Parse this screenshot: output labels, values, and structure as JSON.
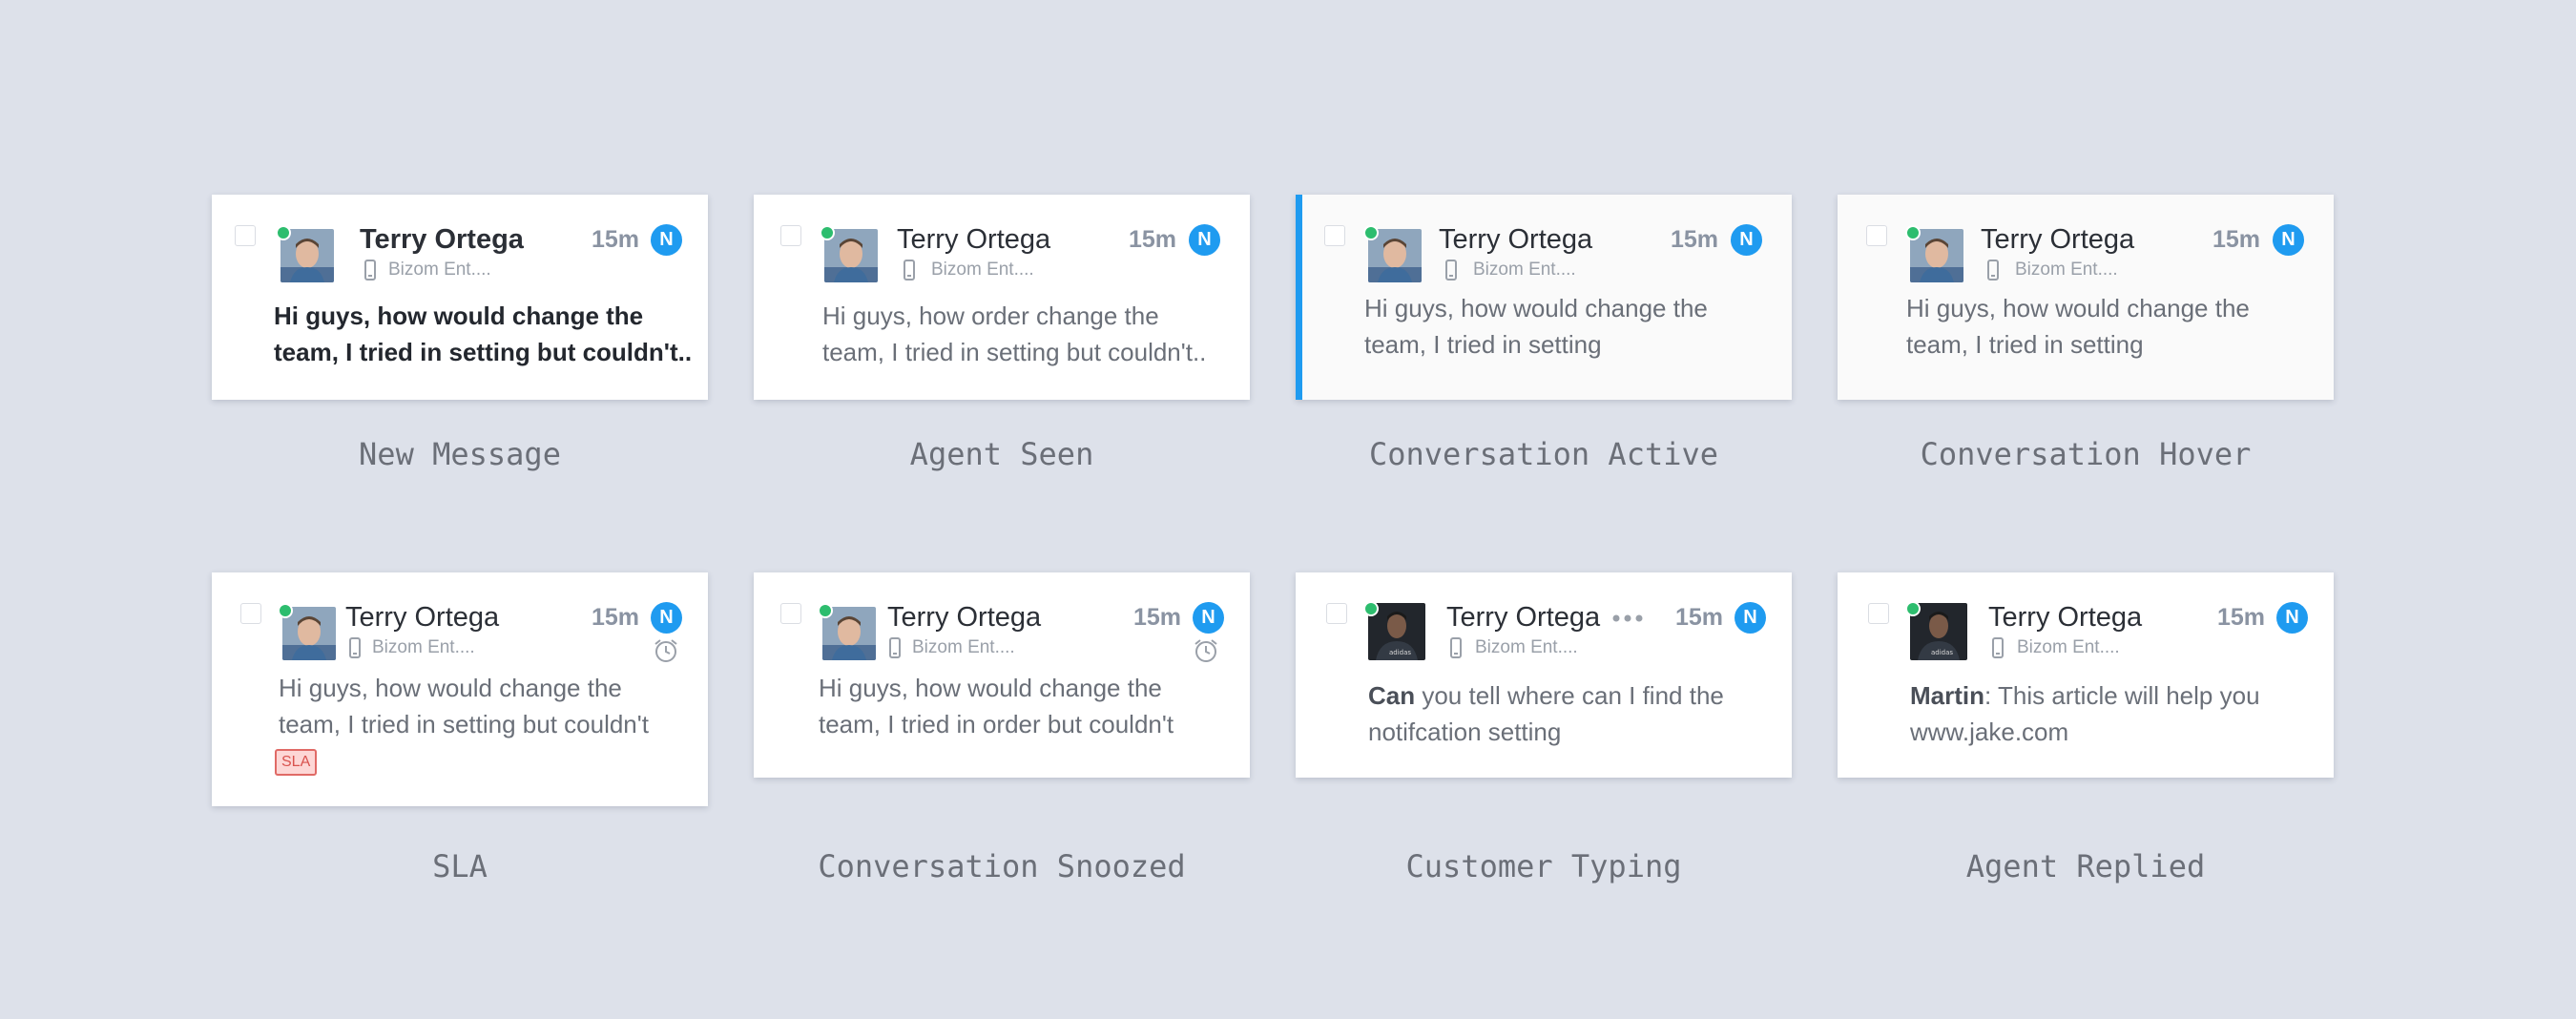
{
  "colors": {
    "background": "#dde1ea",
    "accent": "#1f9bf0",
    "online": "#2dbd6e",
    "sla": "#d9534f"
  },
  "cards": [
    {
      "name": "Terry Ortega",
      "company": "Bizom Ent....",
      "time": "15m",
      "badge": "N",
      "message_line1": "Hi guys, how would change the",
      "message_line2": "team, I tried in setting but couldn't..",
      "caption": "New Message"
    },
    {
      "name": "Terry Ortega",
      "company": "Bizom Ent....",
      "time": "15m",
      "badge": "N",
      "message_line1": "Hi guys, how order change the",
      "message_line2": "team, I tried in setting but couldn't..",
      "caption": "Agent Seen"
    },
    {
      "name": "Terry Ortega",
      "company": "Bizom Ent....",
      "time": "15m",
      "badge": "N",
      "message_line1": "Hi guys, how would change the",
      "message_line2": "team, I tried in setting",
      "caption": "Conversation Active"
    },
    {
      "name": "Terry Ortega",
      "company": "Bizom Ent....",
      "time": "15m",
      "badge": "N",
      "message_line1": "Hi guys, how would change the",
      "message_line2": "team, I tried in setting",
      "caption": "Conversation Hover"
    },
    {
      "name": "Terry Ortega",
      "company": "Bizom Ent....",
      "time": "15m",
      "badge": "N",
      "message_line1": "Hi guys, how would change the",
      "message_line2": "team, I tried in setting but couldn't",
      "sla": "SLA",
      "caption": "SLA"
    },
    {
      "name": "Terry Ortega",
      "company": "Bizom Ent....",
      "time": "15m",
      "badge": "N",
      "message_line1": "Hi guys, how would change the",
      "message_line2": "team, I tried in order but couldn't",
      "caption": "Conversation Snoozed"
    },
    {
      "name": "Terry Ortega",
      "company": "Bizom Ent....",
      "time": "15m",
      "badge": "N",
      "message_prefix": "Can",
      "message_line1": " you tell where can I find the",
      "message_line2": "notifcation setting",
      "caption": "Customer Typing"
    },
    {
      "name": "Terry Ortega",
      "company": "Bizom Ent....",
      "time": "15m",
      "badge": "N",
      "message_prefix": "Martin",
      "message_line1": ": This article will help you",
      "message_line2": "www.jake.com",
      "caption": "Agent Replied"
    }
  ]
}
